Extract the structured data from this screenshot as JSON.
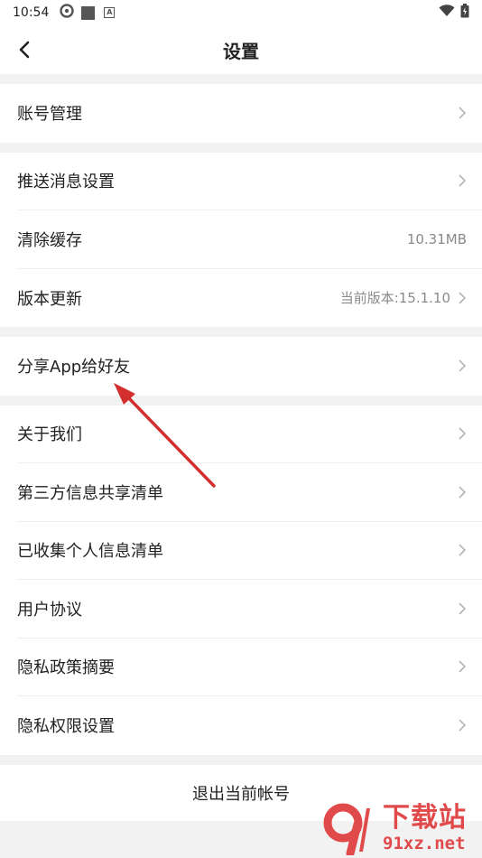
{
  "status_bar": {
    "time": "10:54"
  },
  "header": {
    "title": "设置"
  },
  "groups": [
    {
      "items": [
        {
          "label": "账号管理"
        }
      ]
    },
    {
      "items": [
        {
          "label": "推送消息设置"
        },
        {
          "label": "清除缓存",
          "value": "10.31MB"
        },
        {
          "label": "版本更新",
          "value": "当前版本:15.1.10"
        }
      ]
    },
    {
      "items": [
        {
          "label": "分享App给好友"
        }
      ]
    },
    {
      "items": [
        {
          "label": "关于我们"
        },
        {
          "label": "第三方信息共享清单"
        },
        {
          "label": "已收集个人信息清单"
        },
        {
          "label": "用户协议"
        },
        {
          "label": "隐私政策摘要"
        },
        {
          "label": "隐私权限设置"
        }
      ]
    }
  ],
  "logout": {
    "label": "退出当前帐号"
  },
  "watermark": {
    "main": "下载站",
    "sub": "91xz.net",
    "logo_text": "9"
  },
  "colors": {
    "arrow": "#d32f2f",
    "watermark": "#e14a4a"
  }
}
